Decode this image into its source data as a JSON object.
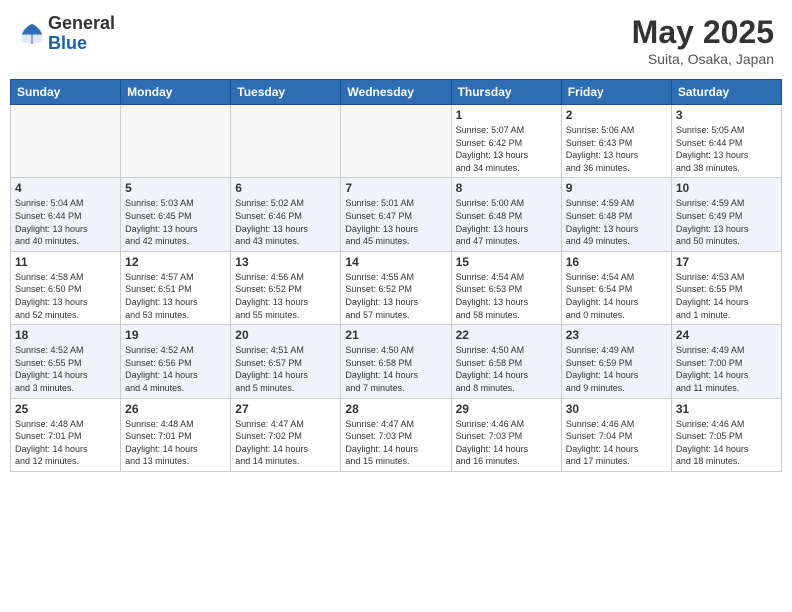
{
  "header": {
    "logo_general": "General",
    "logo_blue": "Blue",
    "month_title": "May 2025",
    "location": "Suita, Osaka, Japan"
  },
  "weekdays": [
    "Sunday",
    "Monday",
    "Tuesday",
    "Wednesday",
    "Thursday",
    "Friday",
    "Saturday"
  ],
  "weeks": [
    [
      {
        "day": "",
        "info": ""
      },
      {
        "day": "",
        "info": ""
      },
      {
        "day": "",
        "info": ""
      },
      {
        "day": "",
        "info": ""
      },
      {
        "day": "1",
        "info": "Sunrise: 5:07 AM\nSunset: 6:42 PM\nDaylight: 13 hours\nand 34 minutes."
      },
      {
        "day": "2",
        "info": "Sunrise: 5:06 AM\nSunset: 6:43 PM\nDaylight: 13 hours\nand 36 minutes."
      },
      {
        "day": "3",
        "info": "Sunrise: 5:05 AM\nSunset: 6:44 PM\nDaylight: 13 hours\nand 38 minutes."
      }
    ],
    [
      {
        "day": "4",
        "info": "Sunrise: 5:04 AM\nSunset: 6:44 PM\nDaylight: 13 hours\nand 40 minutes."
      },
      {
        "day": "5",
        "info": "Sunrise: 5:03 AM\nSunset: 6:45 PM\nDaylight: 13 hours\nand 42 minutes."
      },
      {
        "day": "6",
        "info": "Sunrise: 5:02 AM\nSunset: 6:46 PM\nDaylight: 13 hours\nand 43 minutes."
      },
      {
        "day": "7",
        "info": "Sunrise: 5:01 AM\nSunset: 6:47 PM\nDaylight: 13 hours\nand 45 minutes."
      },
      {
        "day": "8",
        "info": "Sunrise: 5:00 AM\nSunset: 6:48 PM\nDaylight: 13 hours\nand 47 minutes."
      },
      {
        "day": "9",
        "info": "Sunrise: 4:59 AM\nSunset: 6:48 PM\nDaylight: 13 hours\nand 49 minutes."
      },
      {
        "day": "10",
        "info": "Sunrise: 4:59 AM\nSunset: 6:49 PM\nDaylight: 13 hours\nand 50 minutes."
      }
    ],
    [
      {
        "day": "11",
        "info": "Sunrise: 4:58 AM\nSunset: 6:50 PM\nDaylight: 13 hours\nand 52 minutes."
      },
      {
        "day": "12",
        "info": "Sunrise: 4:57 AM\nSunset: 6:51 PM\nDaylight: 13 hours\nand 53 minutes."
      },
      {
        "day": "13",
        "info": "Sunrise: 4:56 AM\nSunset: 6:52 PM\nDaylight: 13 hours\nand 55 minutes."
      },
      {
        "day": "14",
        "info": "Sunrise: 4:55 AM\nSunset: 6:52 PM\nDaylight: 13 hours\nand 57 minutes."
      },
      {
        "day": "15",
        "info": "Sunrise: 4:54 AM\nSunset: 6:53 PM\nDaylight: 13 hours\nand 58 minutes."
      },
      {
        "day": "16",
        "info": "Sunrise: 4:54 AM\nSunset: 6:54 PM\nDaylight: 14 hours\nand 0 minutes."
      },
      {
        "day": "17",
        "info": "Sunrise: 4:53 AM\nSunset: 6:55 PM\nDaylight: 14 hours\nand 1 minute."
      }
    ],
    [
      {
        "day": "18",
        "info": "Sunrise: 4:52 AM\nSunset: 6:55 PM\nDaylight: 14 hours\nand 3 minutes."
      },
      {
        "day": "19",
        "info": "Sunrise: 4:52 AM\nSunset: 6:56 PM\nDaylight: 14 hours\nand 4 minutes."
      },
      {
        "day": "20",
        "info": "Sunrise: 4:51 AM\nSunset: 6:57 PM\nDaylight: 14 hours\nand 5 minutes."
      },
      {
        "day": "21",
        "info": "Sunrise: 4:50 AM\nSunset: 6:58 PM\nDaylight: 14 hours\nand 7 minutes."
      },
      {
        "day": "22",
        "info": "Sunrise: 4:50 AM\nSunset: 6:58 PM\nDaylight: 14 hours\nand 8 minutes."
      },
      {
        "day": "23",
        "info": "Sunrise: 4:49 AM\nSunset: 6:59 PM\nDaylight: 14 hours\nand 9 minutes."
      },
      {
        "day": "24",
        "info": "Sunrise: 4:49 AM\nSunset: 7:00 PM\nDaylight: 14 hours\nand 11 minutes."
      }
    ],
    [
      {
        "day": "25",
        "info": "Sunrise: 4:48 AM\nSunset: 7:01 PM\nDaylight: 14 hours\nand 12 minutes."
      },
      {
        "day": "26",
        "info": "Sunrise: 4:48 AM\nSunset: 7:01 PM\nDaylight: 14 hours\nand 13 minutes."
      },
      {
        "day": "27",
        "info": "Sunrise: 4:47 AM\nSunset: 7:02 PM\nDaylight: 14 hours\nand 14 minutes."
      },
      {
        "day": "28",
        "info": "Sunrise: 4:47 AM\nSunset: 7:03 PM\nDaylight: 14 hours\nand 15 minutes."
      },
      {
        "day": "29",
        "info": "Sunrise: 4:46 AM\nSunset: 7:03 PM\nDaylight: 14 hours\nand 16 minutes."
      },
      {
        "day": "30",
        "info": "Sunrise: 4:46 AM\nSunset: 7:04 PM\nDaylight: 14 hours\nand 17 minutes."
      },
      {
        "day": "31",
        "info": "Sunrise: 4:46 AM\nSunset: 7:05 PM\nDaylight: 14 hours\nand 18 minutes."
      }
    ]
  ]
}
